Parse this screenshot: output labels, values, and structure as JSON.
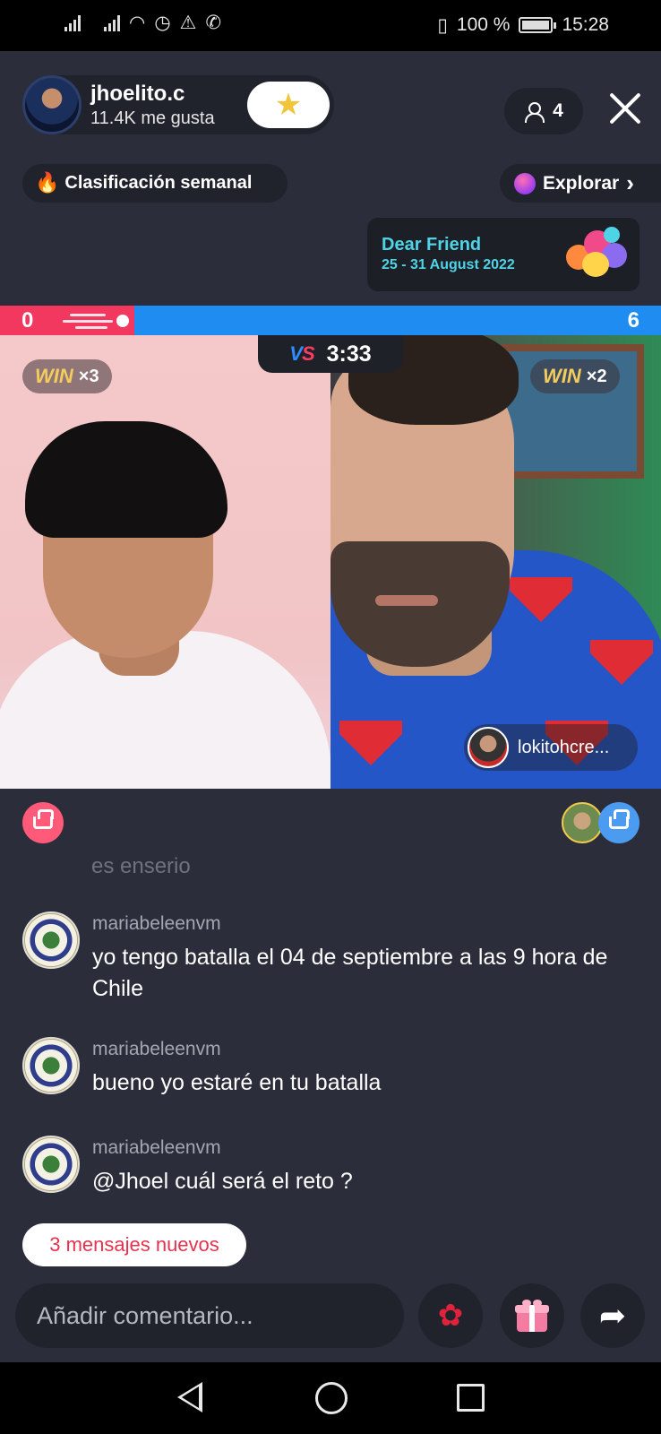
{
  "status_bar": {
    "battery": "100 %",
    "time": "15:28"
  },
  "host": {
    "name": "jhoelito.c",
    "likes": "11.4K me gusta"
  },
  "viewers": {
    "count": "4"
  },
  "ranking": {
    "label": "Clasificación semanal"
  },
  "explore": {
    "label": "Explorar",
    "chevron": "›"
  },
  "promo": {
    "title": "Dear Friend",
    "dates": "25 - 31 August 2022"
  },
  "battle": {
    "score_left": "0",
    "score_right": "6",
    "timer": "3:33",
    "win_word": "WIN",
    "left_wins": "×3",
    "right_wins": "×2",
    "guest_name": "lokitohcre..."
  },
  "chat": {
    "faded_text": "es enserio",
    "messages": [
      {
        "user": "mariabeleenvm",
        "text": "yo tengo batalla el 04 de septiembre a las 9 hora de Chile"
      },
      {
        "user": "mariabeleenvm",
        "text": "bueno yo estaré en tu batalla"
      },
      {
        "user": "mariabeleenvm",
        "text": "@Jhoel cuál será el reto ?"
      }
    ],
    "new_messages": "3 mensajes nuevos"
  },
  "composer": {
    "placeholder": "Añadir comentario..."
  },
  "icons": {
    "follow": "star-icon",
    "close": "close-icon",
    "rose": "rose-icon",
    "gift": "gift-icon",
    "share": "share-icon"
  },
  "colors": {
    "red_team": "#f2385f",
    "blue_team": "#1e8cf0",
    "win": "#f4cc5e",
    "promo": "#4fd3e6"
  }
}
